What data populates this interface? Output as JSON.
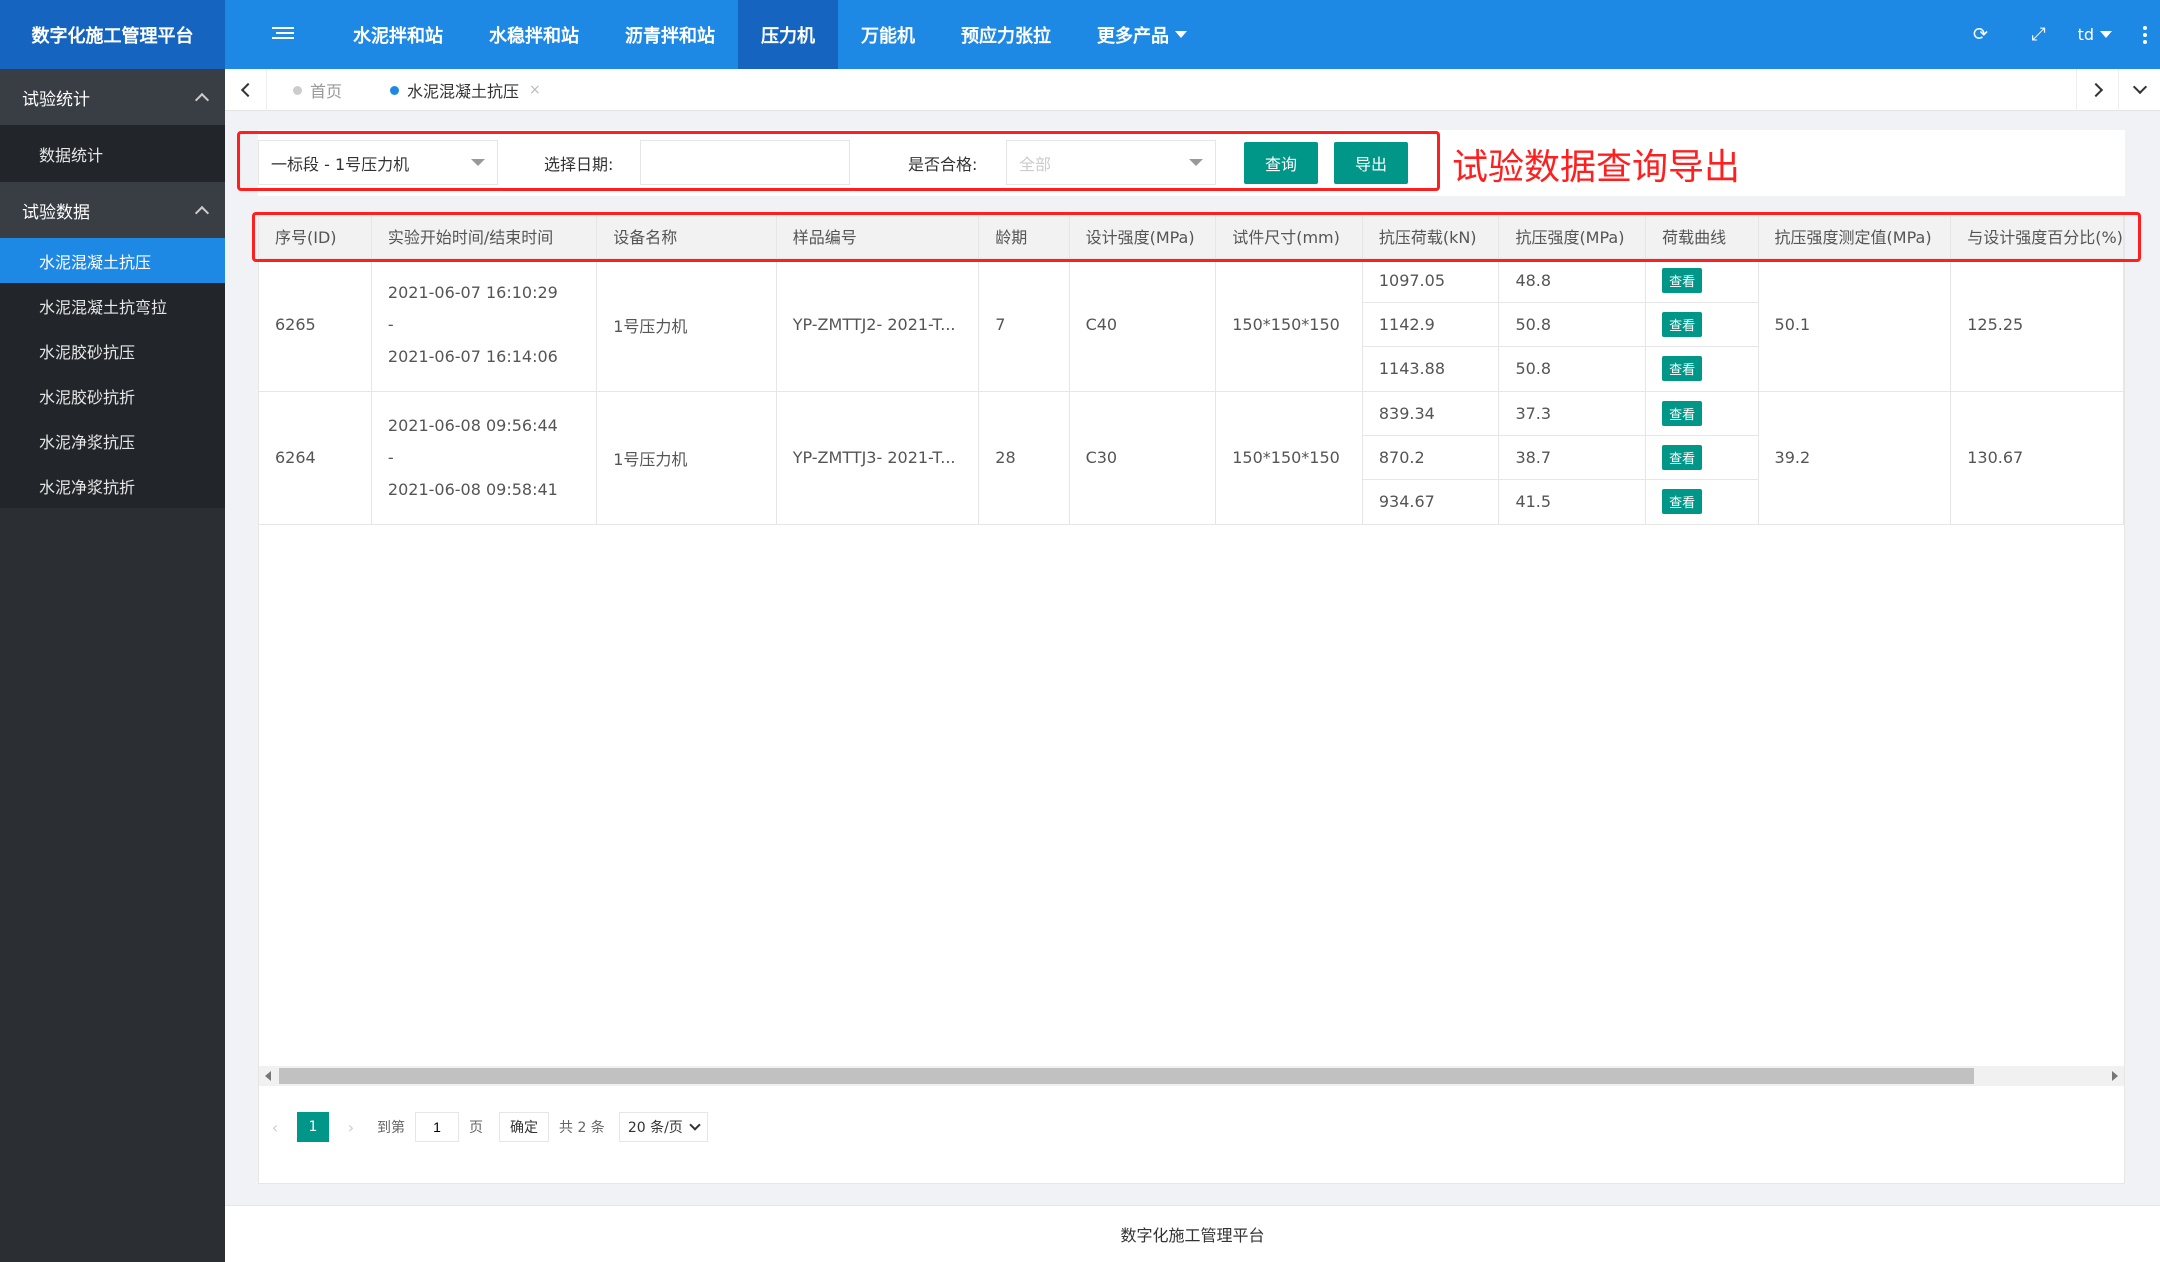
{
  "app": {
    "title": "数字化施工管理平台"
  },
  "nav": {
    "items": [
      {
        "label": "水泥拌和站"
      },
      {
        "label": "水稳拌和站"
      },
      {
        "label": "沥青拌和站"
      },
      {
        "label": "压力机"
      },
      {
        "label": "万能机"
      },
      {
        "label": "预应力张拉"
      },
      {
        "label": "更多产品"
      }
    ],
    "active": "压力机",
    "user": "td"
  },
  "sidebar": {
    "groups": [
      {
        "label": "试验统计",
        "items": [
          {
            "label": "数据统计"
          }
        ]
      },
      {
        "label": "试验数据",
        "items": [
          {
            "label": "水泥混凝土抗压"
          },
          {
            "label": "水泥混凝土抗弯拉"
          },
          {
            "label": "水泥胶砂抗压"
          },
          {
            "label": "水泥胶砂抗折"
          },
          {
            "label": "水泥净浆抗压"
          },
          {
            "label": "水泥净浆抗折"
          }
        ]
      }
    ],
    "active": "水泥混凝土抗压"
  },
  "tabs": {
    "home": "首页",
    "current": "水泥混凝土抗压",
    "close": "×"
  },
  "filter": {
    "machine": "一标段 - 1号压力机",
    "date_label": "选择日期:",
    "date_value": "",
    "qualified_label": "是否合格:",
    "qualified_value": "全部",
    "query_label": "查询",
    "export_label": "导出"
  },
  "annotation": "试验数据查询导出",
  "table": {
    "headers": [
      "序号(ID)",
      "实验开始时间/结束时间",
      "设备名称",
      "样品编号",
      "龄期",
      "设计强度(MPa)",
      "试件尺寸(mm)",
      "抗压荷载(kN)",
      "抗压强度(MPa)",
      "荷载曲线",
      "抗压强度测定值(MPa)",
      "与设计强度百分比(%)"
    ],
    "view_label": "查看",
    "rows": [
      {
        "id": "6265",
        "start": "2021-06-07 16:10:29",
        "sep": "-",
        "end": "2021-06-07 16:14:06",
        "device": "1号压力机",
        "sample": "YP-ZMTTJ2- 2021-T...",
        "age": "7",
        "design": "C40",
        "size": "150*150*150",
        "loads": [
          "1097.05",
          "1142.9",
          "1143.88"
        ],
        "strengths": [
          "48.8",
          "50.8",
          "50.8"
        ],
        "measured": "50.1",
        "percent": "125.25"
      },
      {
        "id": "6264",
        "start": "2021-06-08 09:56:44",
        "sep": "-",
        "end": "2021-06-08 09:58:41",
        "device": "1号压力机",
        "sample": "YP-ZMTTJ3- 2021-T...",
        "age": "28",
        "design": "C30",
        "size": "150*150*150",
        "loads": [
          "839.34",
          "870.2",
          "934.67"
        ],
        "strengths": [
          "37.3",
          "38.7",
          "41.5"
        ],
        "measured": "39.2",
        "percent": "130.67"
      }
    ]
  },
  "pager": {
    "current": "1",
    "goto_label": "到第",
    "goto_value": "1",
    "page_unit": "页",
    "confirm": "确定",
    "total": "共 2 条",
    "page_size": "20 条/页"
  },
  "footer": "数字化施工管理平台",
  "colors": {
    "primary": "#1e88e5",
    "primary_dark": "#1565c0",
    "sidebar": "#2b2e33",
    "button": "#009688",
    "annotation": "#ff1f1f"
  }
}
